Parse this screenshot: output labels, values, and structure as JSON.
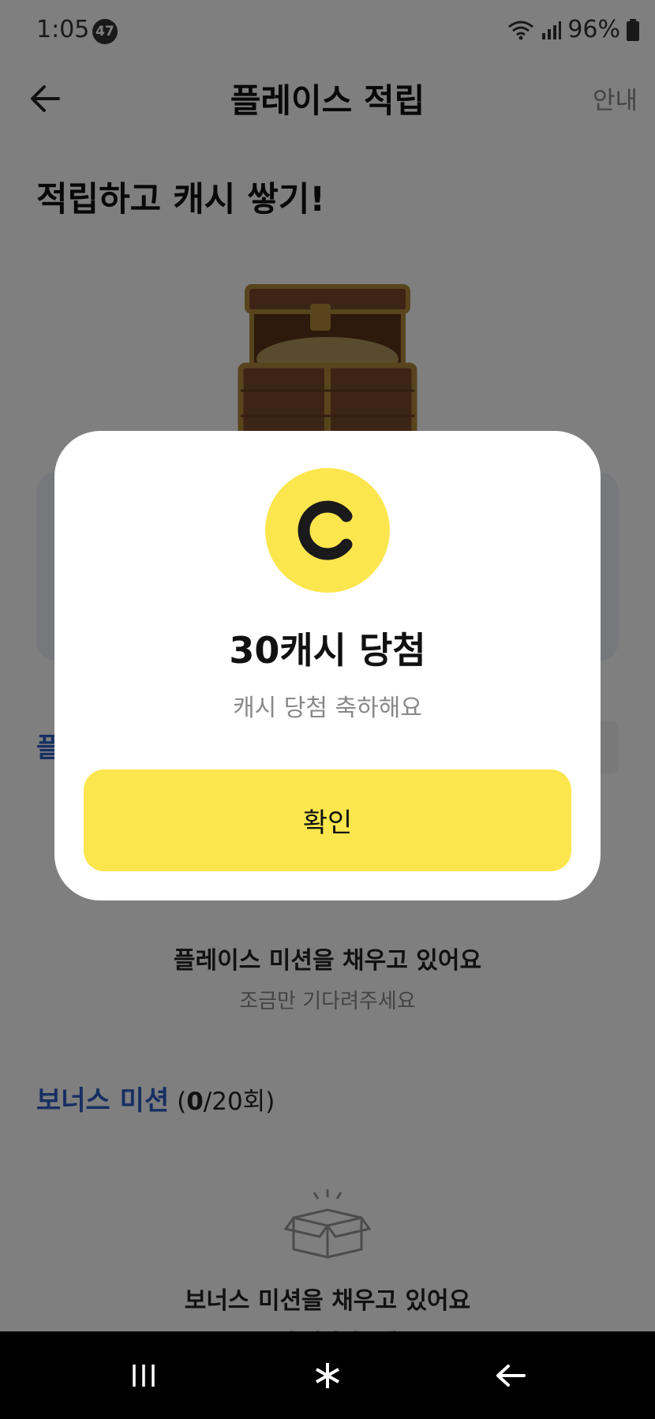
{
  "status_bar": {
    "time": "1:05",
    "notification_count": "47",
    "battery": "96%"
  },
  "header": {
    "title": "플레이스 적립",
    "guide_label": "안내"
  },
  "hero": {
    "title": "적립하고 캐시 쌓기!"
  },
  "place_section": {
    "peek_label": "플",
    "empty_title": "플레이스 미션을 채우고 있어요",
    "empty_sub": "조금만 기다려주세요"
  },
  "bonus_section": {
    "heading": "보너스 미션",
    "count_open": " (",
    "count_done": "0",
    "count_total": "/20회)",
    "empty_title": "보너스 미션을 채우고 있어요",
    "empty_sub": "조금만 기다려주세요"
  },
  "modal": {
    "coin_letter": "C",
    "title": "30캐시 당첨",
    "subtitle": "캐시 당첨 축하해요",
    "confirm_label": "확인"
  },
  "icons": {
    "back": "arrow-left-icon",
    "chest": "treasure-chest-icon",
    "coin": "cash-coin-icon",
    "empty_box": "open-box-icon",
    "nav_recents": "recents-icon",
    "nav_home": "home-icon",
    "nav_back": "back-icon"
  },
  "colors": {
    "accent_yellow": "#fbe64e",
    "link_blue": "#2f5fc4",
    "overlay": "rgba(0,0,0,0.5)"
  }
}
